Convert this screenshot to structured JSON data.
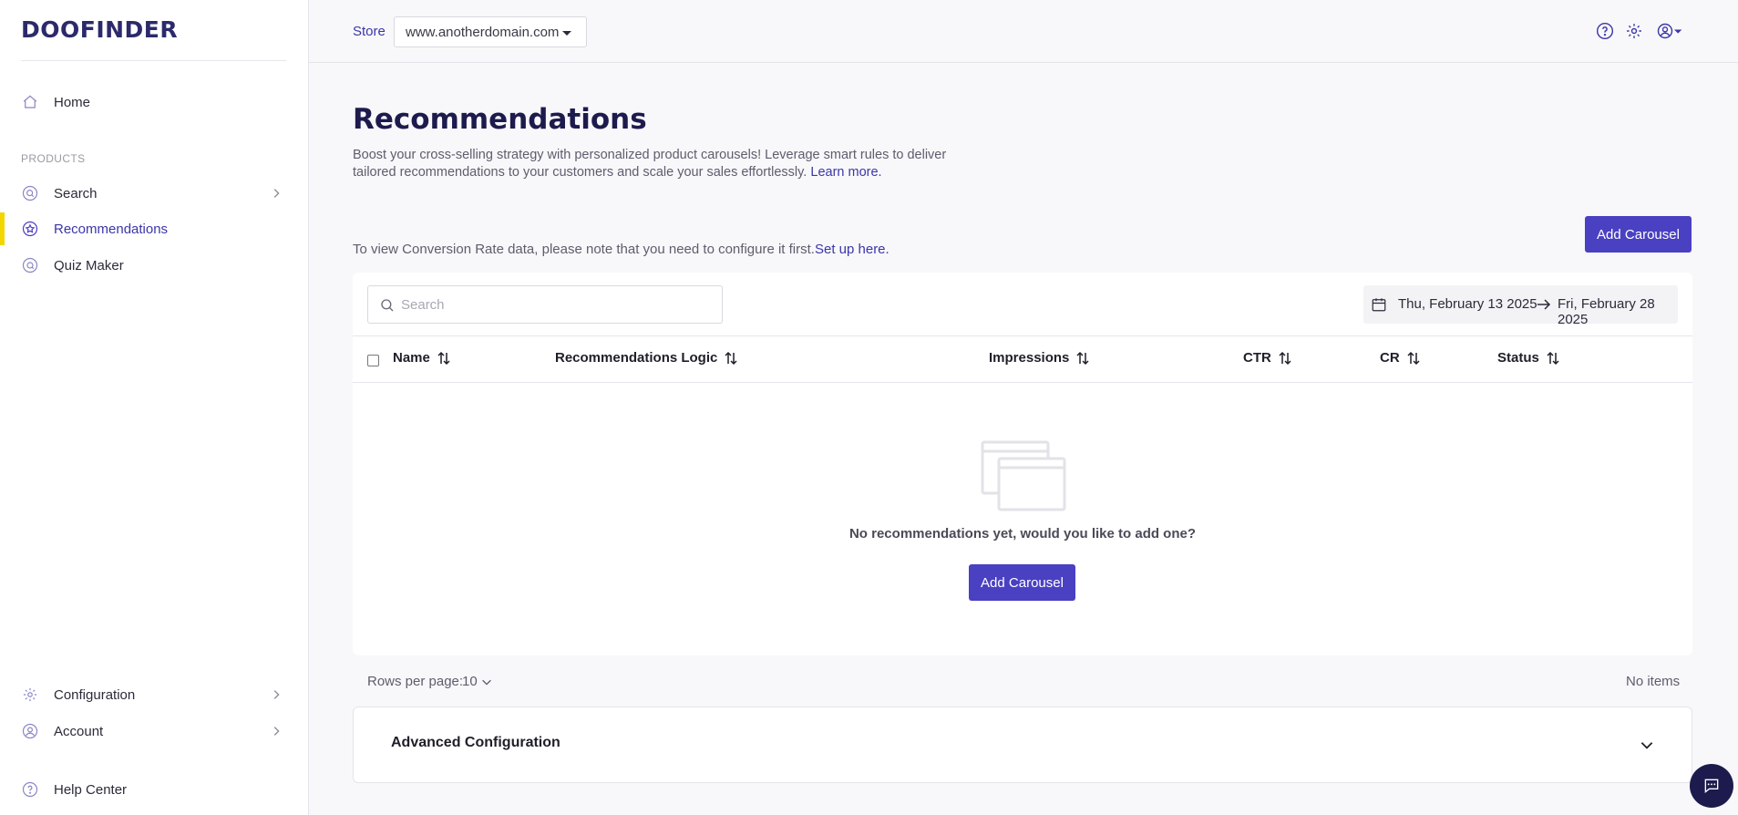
{
  "brand": {
    "logo_text": "DOOFINDER",
    "accent": "#4a40c2",
    "active_marker": "#f2d600"
  },
  "sidebar": {
    "home": "Home",
    "section_label": "PRODUCTS",
    "search": "Search",
    "recommendations": "Recommendations",
    "quiz_maker": "Quiz Maker",
    "configuration": "Configuration",
    "account": "Account",
    "help_center": "Help Center"
  },
  "topbar": {
    "store_label": "Store",
    "store_value": "www.anotherdomain.com",
    "icons": [
      "help-icon",
      "settings-gear-icon",
      "user-account-icon"
    ]
  },
  "page": {
    "title": "Recommendations",
    "description": "Boost your cross-selling strategy with personalized product carousels! Leverage smart rules to deliver tailored recommendations to your customers and scale your sales effortlessly.",
    "learn_more": "Learn more.",
    "add_carousel_label": "Add Carousel",
    "notice_text": "To view Conversion Rate data, please note that you need to configure it first.",
    "notice_link": "Set up here."
  },
  "table": {
    "search_placeholder": "Search",
    "date_from": "Thu, February 13 2025",
    "date_to": "Fri, February 28 2025",
    "columns": [
      "Name",
      "Recommendations Logic",
      "Impressions",
      "CTR",
      "CR",
      "Status"
    ],
    "empty_message": "No recommendations yet, would you like to add one?",
    "empty_button": "Add Carousel"
  },
  "pagination": {
    "rows_label": "Rows per page:",
    "rows_value": "10",
    "items_text": "No items"
  },
  "advanced": {
    "title": "Advanced Configuration"
  }
}
